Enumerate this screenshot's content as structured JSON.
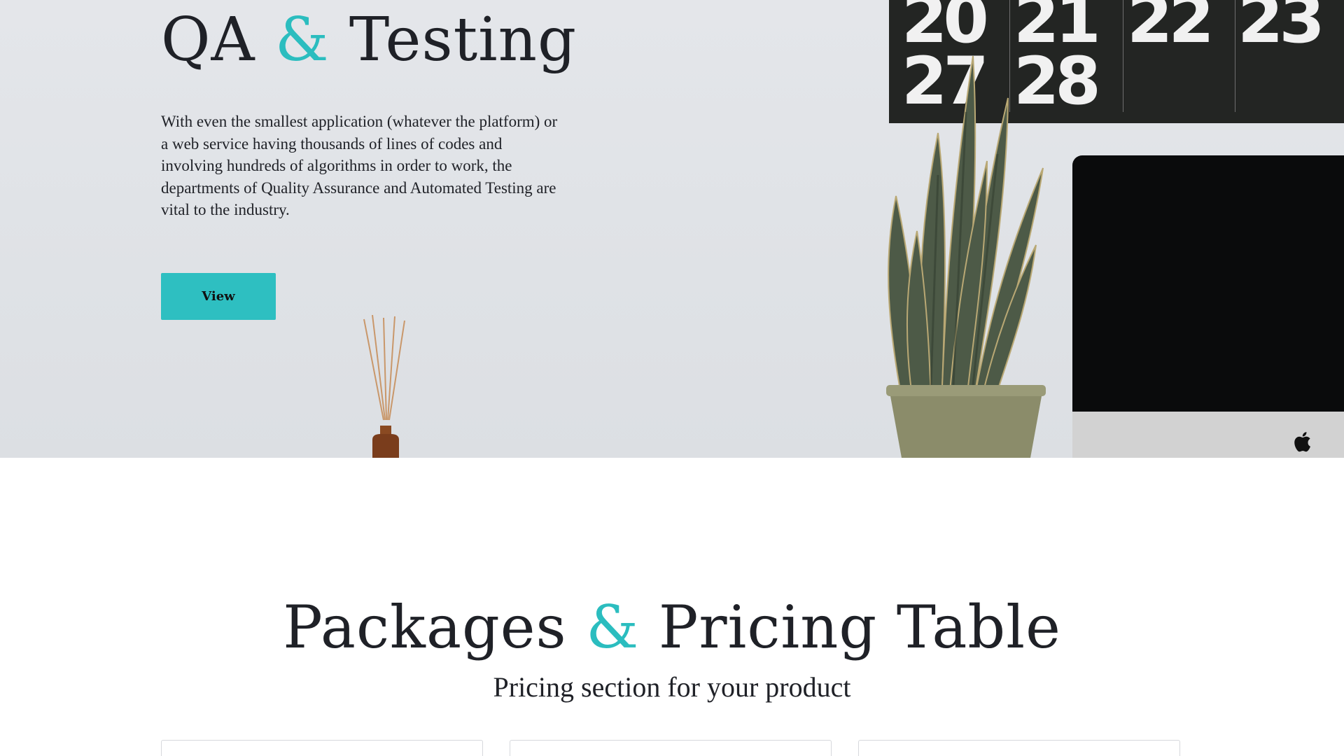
{
  "hero": {
    "title_left": "QA",
    "title_amp": "&",
    "title_right": "Testing",
    "description": "With even the smallest application (whatever the platform) or a web service having thousands of lines of codes and involving hundreds of algorithms in order to work, the departments of Quality Assurance and Automated Testing are vital to the industry.",
    "button_label": "View"
  },
  "calendar": {
    "row1": [
      "20",
      "21",
      "22",
      "23"
    ],
    "row2": [
      "27",
      "28"
    ]
  },
  "pricing": {
    "title_left": "Packages",
    "title_amp": "&",
    "title_right": "Pricing Table",
    "subtitle": "Pricing section for your product",
    "card_count": 3
  },
  "colors": {
    "accent": "#2ebfc1",
    "text": "#1f2127",
    "hero_bg": "#e1e3e7"
  }
}
